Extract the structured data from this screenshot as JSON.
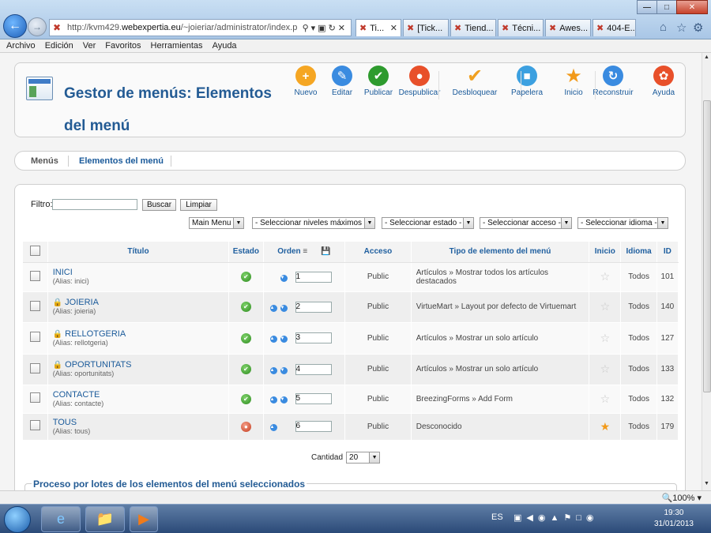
{
  "browser": {
    "url_prefix": "http://kvm429.",
    "url_domain": "webexpertia.eu",
    "url_rest": "/~joieriar/administrator/index.p",
    "tabs": [
      {
        "label": "Ti...",
        "active": true
      },
      {
        "label": "[Tick...",
        "active": false
      },
      {
        "label": "Tiend...",
        "active": false
      },
      {
        "label": "Técni...",
        "active": false
      },
      {
        "label": "Awes...",
        "active": false
      },
      {
        "label": "404-E...",
        "active": false
      }
    ],
    "menu": [
      "Archivo",
      "Edición",
      "Ver",
      "Favoritos",
      "Herramientas",
      "Ayuda"
    ]
  },
  "page": {
    "title": "Gestor de menús: Elementos del menú"
  },
  "toolbar": [
    {
      "label": "Nuevo",
      "icon": "plus-icon",
      "color": "#f5a623"
    },
    {
      "label": "Editar",
      "icon": "pencil-icon",
      "color": "#3a8be0"
    },
    {
      "label": "Publicar",
      "icon": "check-icon",
      "color": "#2e9b2e"
    },
    {
      "label": "Despublicar",
      "icon": "unpublish-icon",
      "color": "#e8502a"
    },
    {
      "label": "Desbloquear",
      "icon": "checkmark-icon",
      "color": "#f0a020"
    },
    {
      "label": "Papelera",
      "icon": "trash-icon",
      "color": "#3ca0e0"
    },
    {
      "label": "Inicio",
      "icon": "star-icon",
      "color": "#f29a1a"
    },
    {
      "label": "Reconstruir",
      "icon": "refresh-icon",
      "color": "#3a8be0"
    },
    {
      "label": "Ayuda",
      "icon": "lifebuoy-icon",
      "color": "#e8502a"
    }
  ],
  "subnav": {
    "menus": "Menús",
    "items": "Elementos del menú"
  },
  "filter": {
    "label": "Filtro:",
    "search_button": "Buscar",
    "clear_button": "Limpiar",
    "selects": [
      "Main Menu",
      "- Seleccionar niveles máximos -",
      "- Seleccionar estado -",
      "- Seleccionar acceso -",
      "- Seleccionar idioma -"
    ]
  },
  "table": {
    "headers": {
      "title": "Título",
      "state": "Estado",
      "order": "Orden",
      "access": "Acceso",
      "type": "Tipo de elemento del menú",
      "home": "Inicio",
      "language": "Idioma",
      "id": "ID"
    },
    "alias_prefix": "(Alias:",
    "rows": [
      {
        "title": "INICI",
        "alias": "inici)",
        "locked": false,
        "state": "published",
        "order": "1",
        "up": false,
        "down": true,
        "access": "Public",
        "type": "Artículos » Mostrar todos los artículos destacados",
        "home": false,
        "language": "Todos",
        "id": "101"
      },
      {
        "title": "JOIERIA",
        "alias": "joieria)",
        "locked": true,
        "state": "published",
        "order": "2",
        "up": true,
        "down": true,
        "access": "Public",
        "type": "VirtueMart » Layout por defecto de Virtuemart",
        "home": false,
        "language": "Todos",
        "id": "140"
      },
      {
        "title": "RELLOTGERIA",
        "alias": "rellotgeria)",
        "locked": true,
        "state": "published",
        "order": "3",
        "up": true,
        "down": true,
        "access": "Public",
        "type": "Artículos » Mostrar un solo artículo",
        "home": false,
        "language": "Todos",
        "id": "127"
      },
      {
        "title": "OPORTUNITATS",
        "alias": "oportunitats)",
        "locked": true,
        "state": "published",
        "order": "4",
        "up": true,
        "down": true,
        "access": "Public",
        "type": "Artículos » Mostrar un solo artículo",
        "home": false,
        "language": "Todos",
        "id": "133"
      },
      {
        "title": "CONTACTE",
        "alias": "contacte)",
        "locked": false,
        "state": "published",
        "order": "5",
        "up": true,
        "down": true,
        "access": "Public",
        "type": "BreezingForms » Add Form",
        "home": false,
        "language": "Todos",
        "id": "132"
      },
      {
        "title": "TOUS",
        "alias": "tous)",
        "locked": false,
        "state": "unpublished",
        "order": "6",
        "up": true,
        "down": false,
        "access": "Public",
        "type": "Desconocido",
        "home": true,
        "language": "Todos",
        "id": "179"
      }
    ]
  },
  "pagination": {
    "label": "Cantidad",
    "value": "20"
  },
  "batch": {
    "legend": "Proceso por lotes de los elementos del menú seleccionados"
  },
  "status": {
    "zoom": "100%"
  },
  "taskbar": {
    "lang": "ES",
    "time": "19:30",
    "date": "31/01/2013"
  }
}
